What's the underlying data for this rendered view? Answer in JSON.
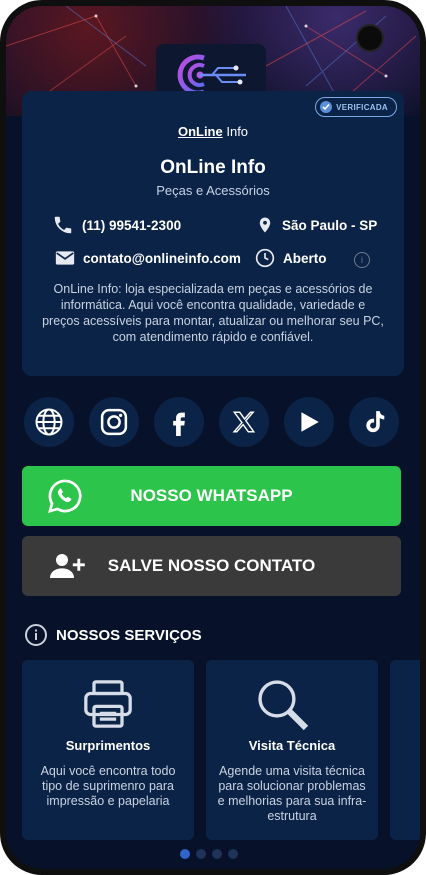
{
  "header": {
    "badge": "VERIFICADA",
    "brand_bold": "OnLine",
    "brand_rest": " Info"
  },
  "profile": {
    "title": "OnLine Info",
    "subtitle": "Peças e Acessórios",
    "phone": "(11) 99541-2300",
    "location": "São Paulo - SP",
    "email": "contato@onlineinfo.com",
    "hours": "Aberto",
    "description": "OnLine Info: loja especializada em peças e acessórios de informática. Aqui você encontra qualidade, variedade e preços acessíveis para montar, atualizar ou melhorar seu PC, com atendimento rápido e confiável."
  },
  "social": [
    "website-icon",
    "instagram-icon",
    "facebook-icon",
    "x-icon",
    "youtube-icon",
    "tiktok-icon"
  ],
  "buttons": {
    "whatsapp": "NOSSO WHATSAPP",
    "contact": "SALVE NOSSO CONTATO"
  },
  "services": {
    "heading": "NOSSOS SERVIÇOS",
    "items": [
      {
        "title": "Surprimentos",
        "description": "Aqui você encontra todo tipo de suprimenro para impressão e papelaria",
        "icon": "printer-icon"
      },
      {
        "title": "Visita Técnica",
        "description": "Agende uma visita técnica para solucionar problemas e melhorias para sua infra-estrutura",
        "icon": "magnifier-icon"
      }
    ]
  },
  "pagination": {
    "active_index": 0,
    "count": 4
  },
  "colors": {
    "background": "#07122a",
    "card": "#0b2346",
    "whatsapp": "#2cc44a",
    "contact": "#3a3a3a",
    "active_dot": "#2f64c9"
  }
}
